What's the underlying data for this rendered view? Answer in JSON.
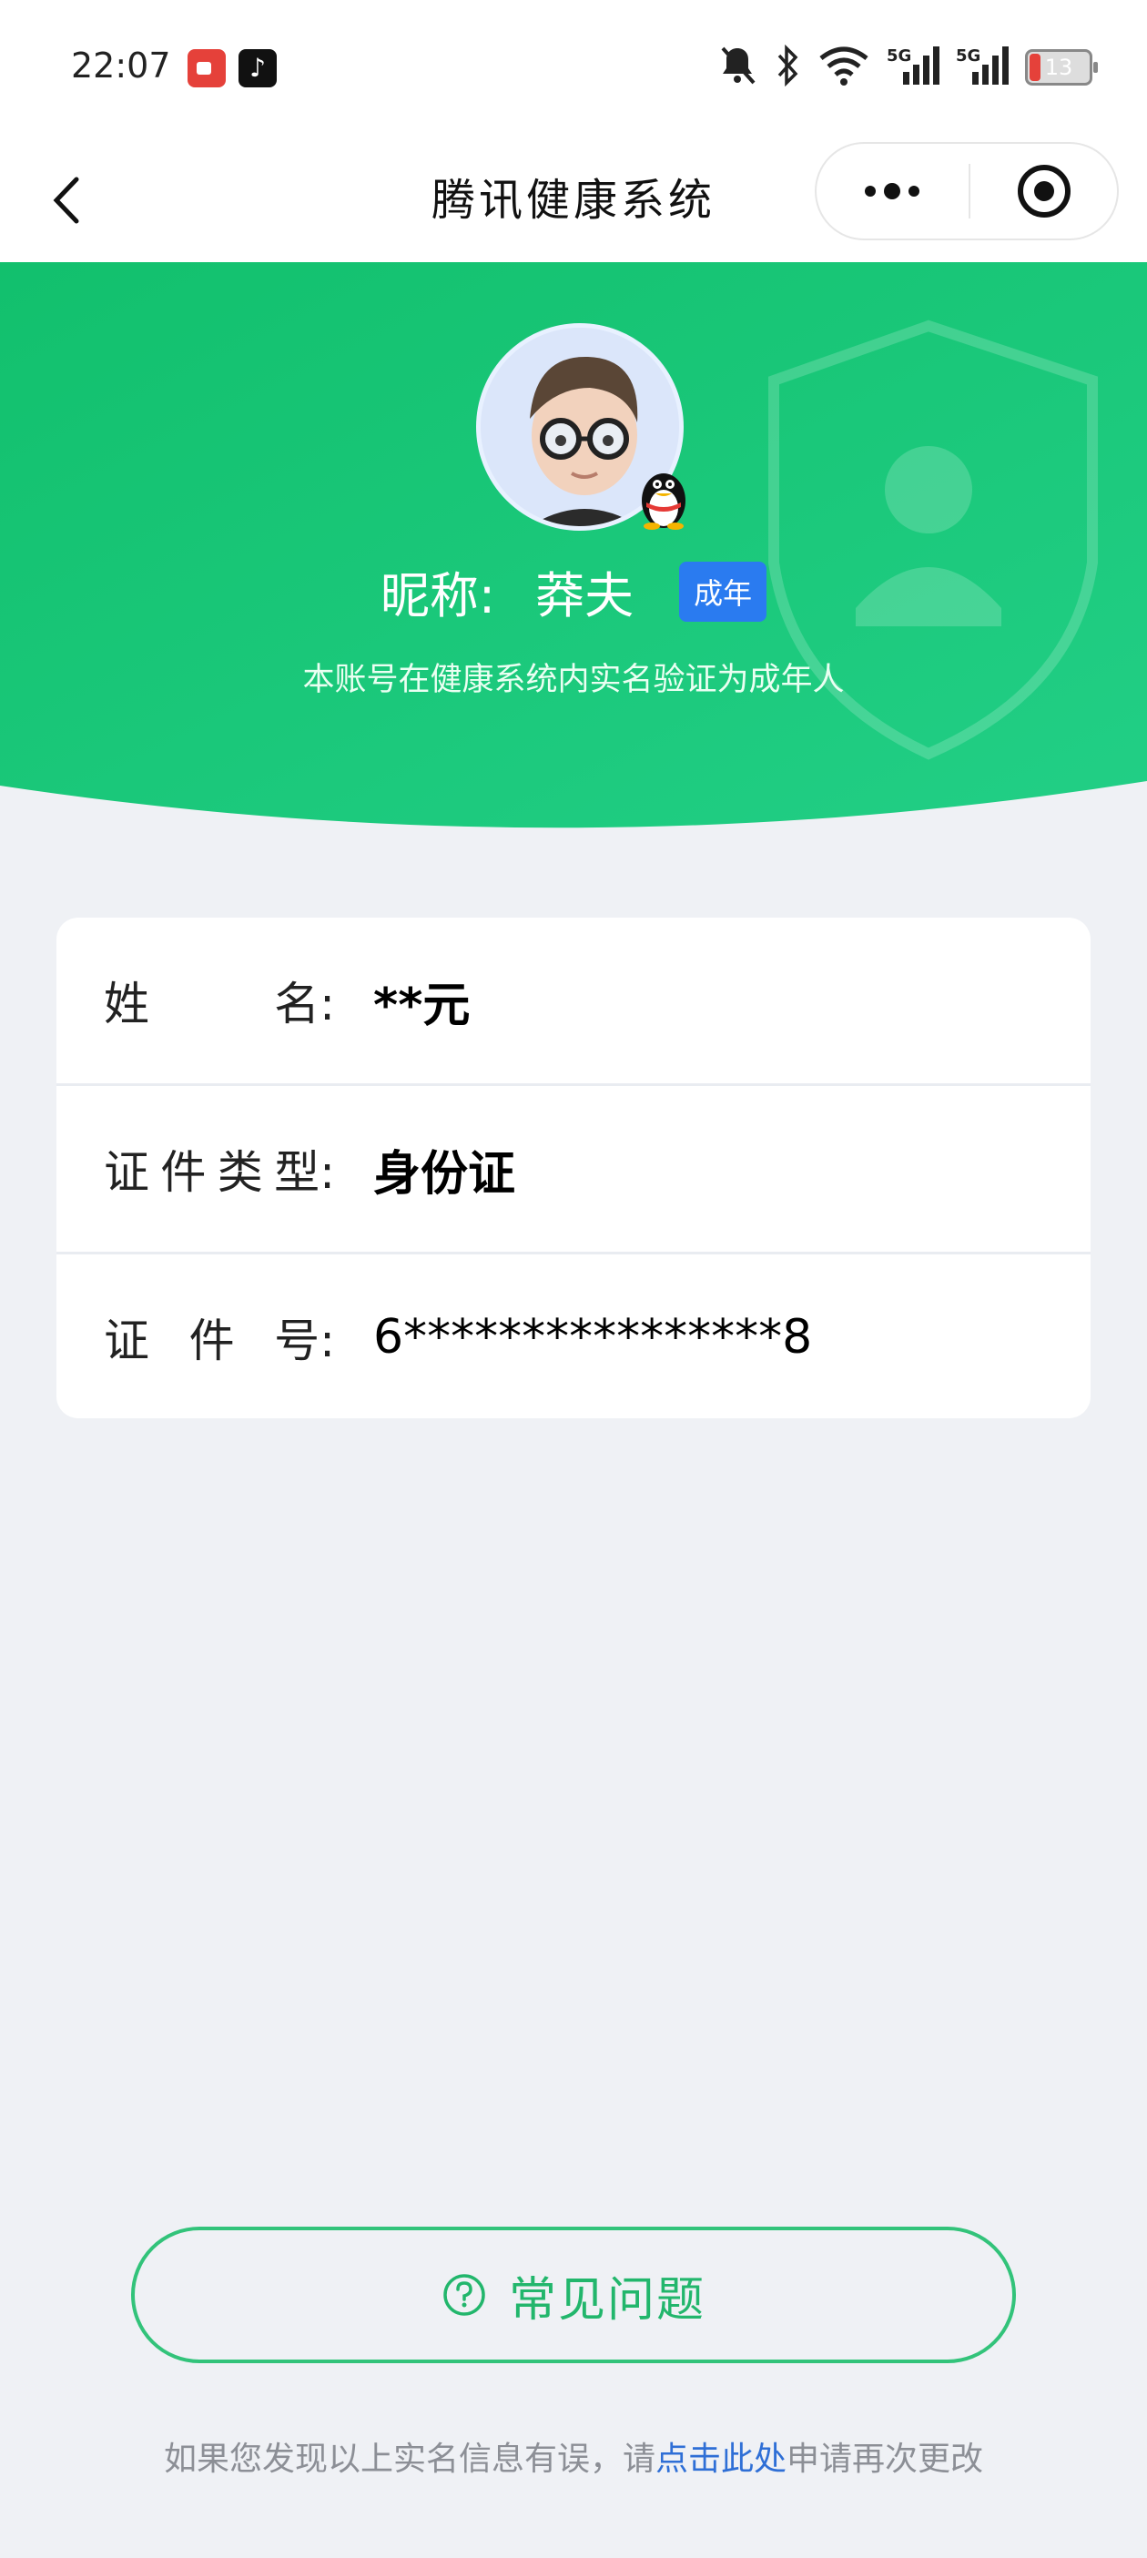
{
  "status_bar": {
    "time": "22:07",
    "tiktok_glyph": "♪",
    "battery": "13",
    "signal_label_1": "5G",
    "signal_label_2": "5G",
    "icons": [
      "record-app-icon",
      "tiktok-app-icon",
      "mute-icon",
      "bluetooth-icon",
      "wifi-icon",
      "signal-5g-icon",
      "signal-5g-icon",
      "battery-icon"
    ]
  },
  "nav": {
    "title": "腾讯健康系统",
    "back_icon": "chevron-left-icon",
    "more_icon": "more-dots-icon",
    "close_icon": "target-close-icon"
  },
  "profile": {
    "nickname_label": "昵称:",
    "nickname": "莽夫",
    "age_tag": "成年",
    "verify_text": "本账号在健康系统内实名验证为成年人"
  },
  "info_rows": [
    {
      "label_chars": [
        "姓",
        "名:"
      ],
      "value": "**元"
    },
    {
      "label_chars": [
        "证",
        "件",
        "类",
        "型:"
      ],
      "value": "身份证"
    },
    {
      "label_chars": [
        "证",
        "件",
        "号:"
      ],
      "value": "6****************8"
    }
  ],
  "faq": {
    "label": "常见问题",
    "icon": "question-circle-icon"
  },
  "footer": {
    "prefix": "如果您发现以上实名信息有误，请",
    "link": "点击此处",
    "suffix": "申请再次更改"
  },
  "colors": {
    "header_green": "#16c474",
    "tag_blue": "#2a7bf0",
    "faq_green": "#22b66c",
    "link_blue": "#2f6fd6",
    "page_bg": "#eff1f5"
  }
}
